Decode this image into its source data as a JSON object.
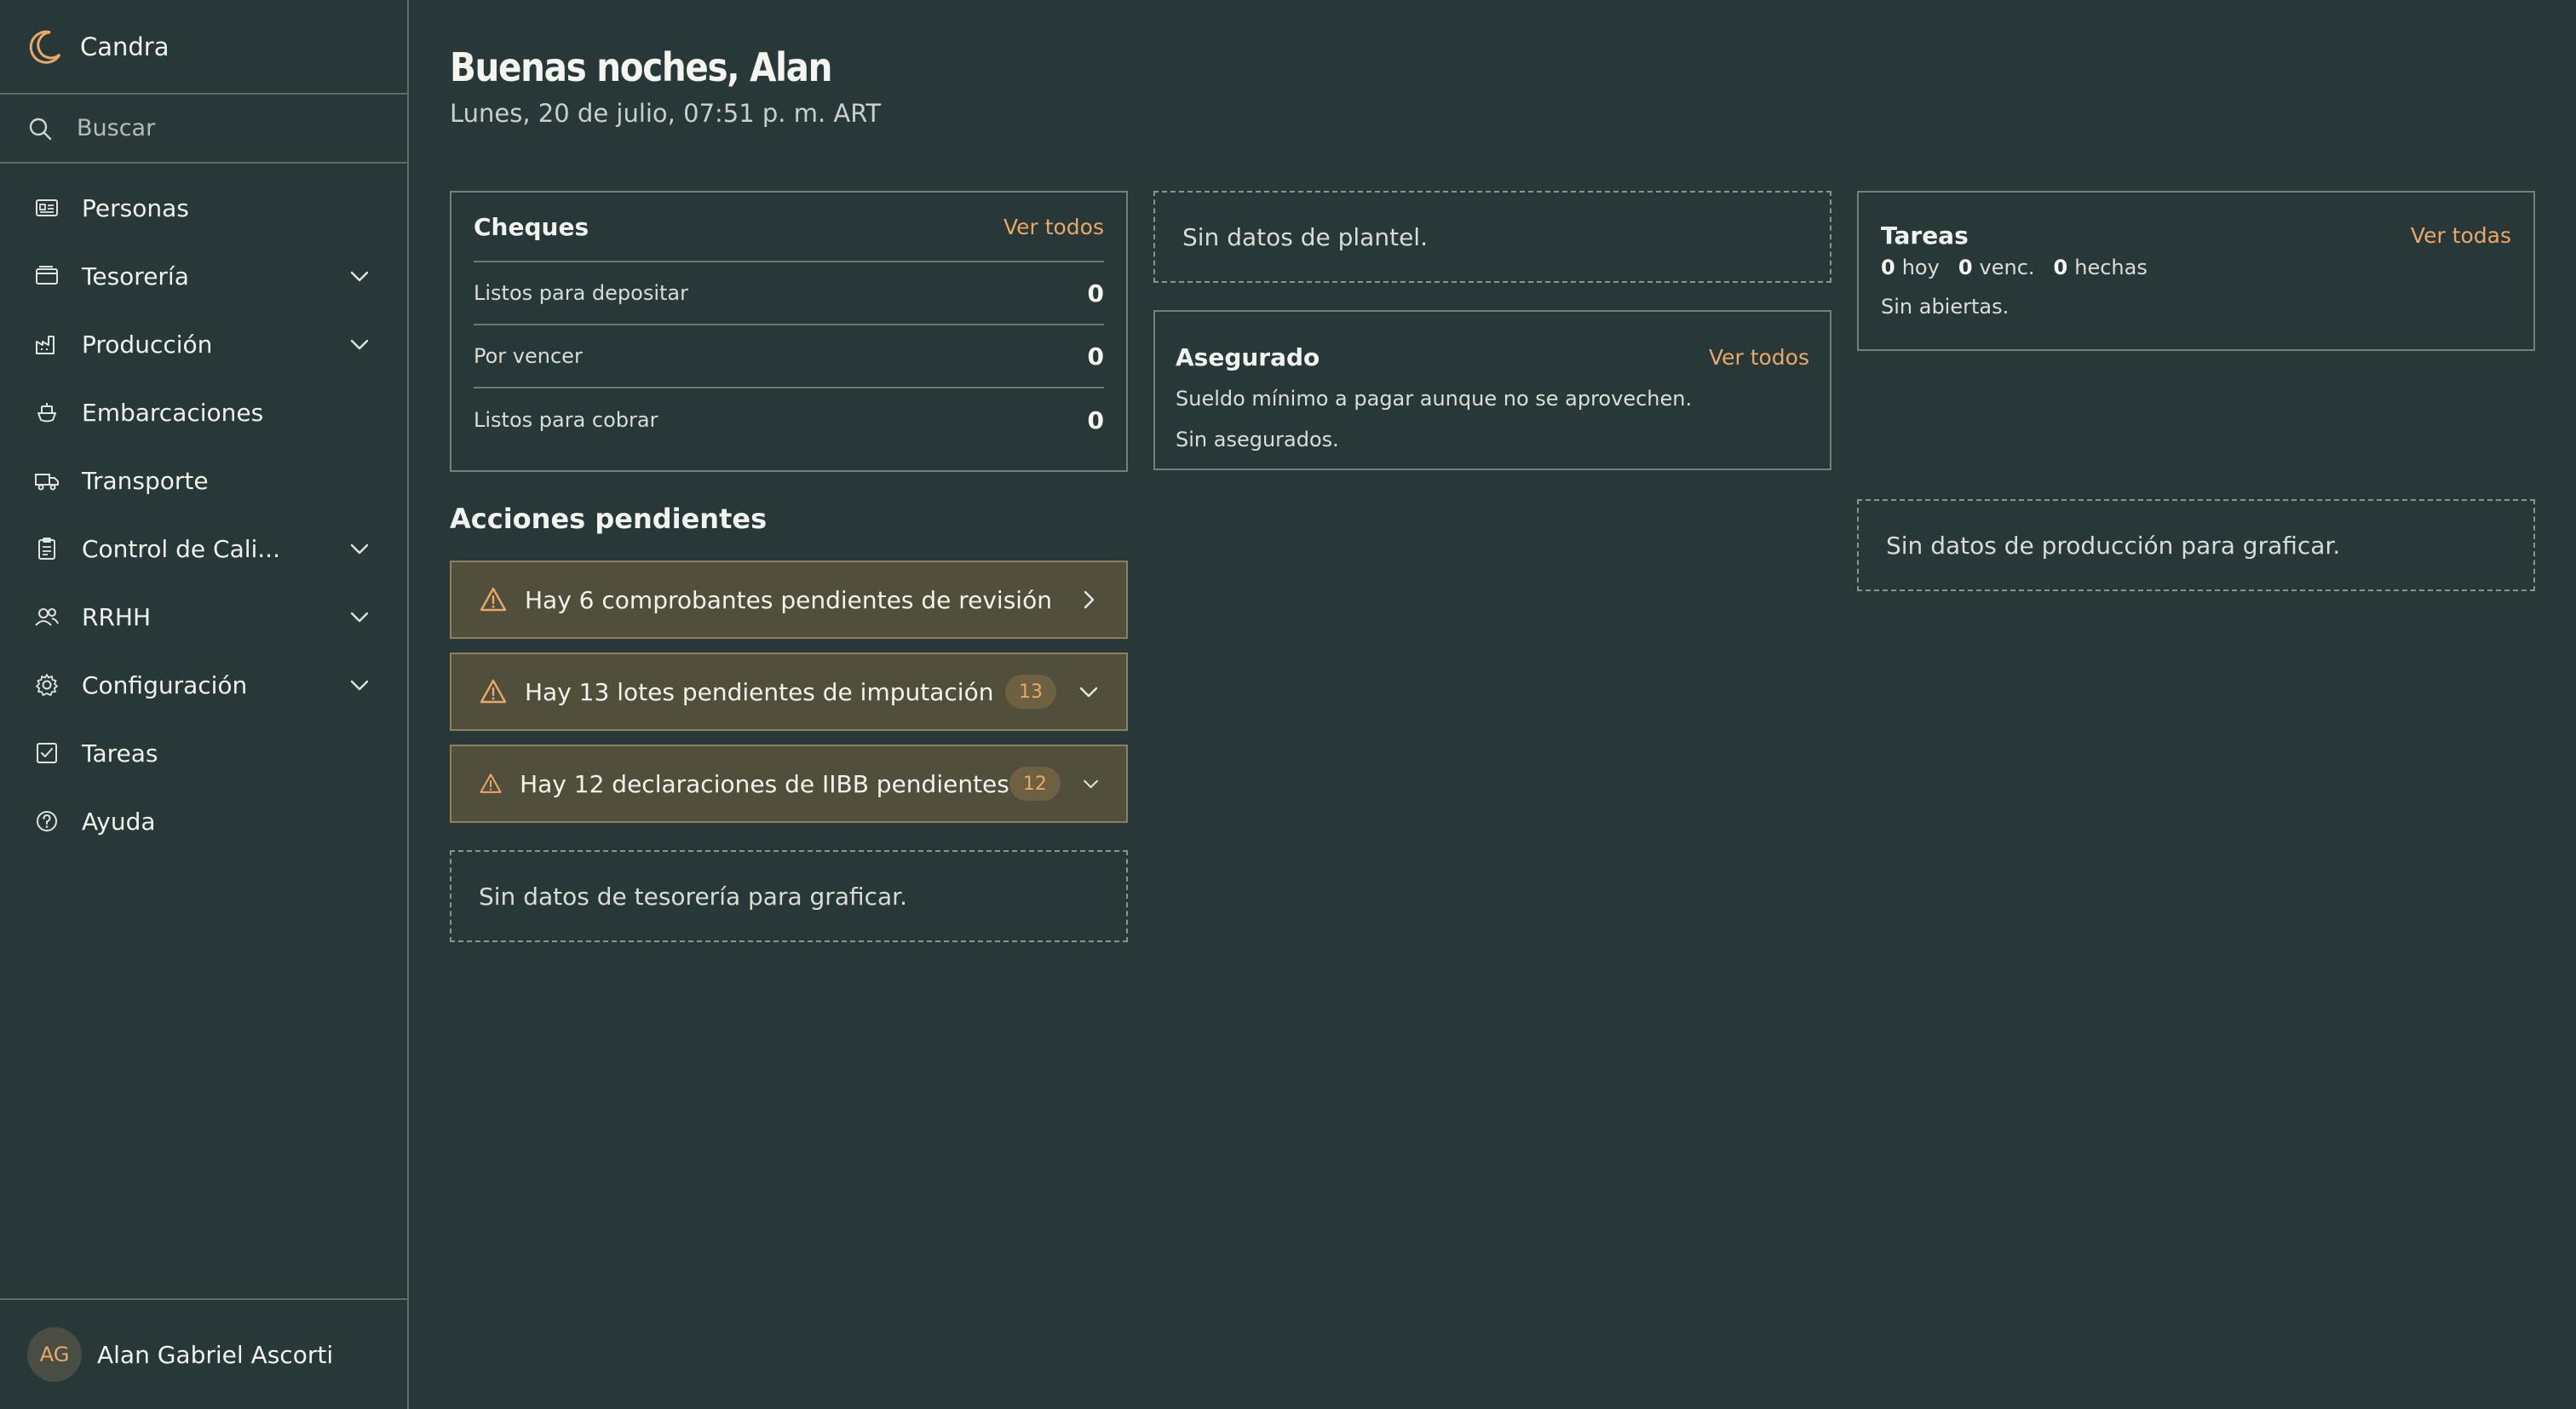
{
  "app": {
    "name": "Candra"
  },
  "sidebar": {
    "search_placeholder": "Buscar",
    "items": [
      {
        "label": "Personas",
        "icon": "id-card-icon",
        "expandable": false
      },
      {
        "label": "Tesorería",
        "icon": "wallet-icon",
        "expandable": true
      },
      {
        "label": "Producción",
        "icon": "factory-icon",
        "expandable": true
      },
      {
        "label": "Embarcaciones",
        "icon": "ship-icon",
        "expandable": false
      },
      {
        "label": "Transporte",
        "icon": "truck-icon",
        "expandable": false
      },
      {
        "label": "Control de Cali...",
        "icon": "clipboard-icon",
        "expandable": true
      },
      {
        "label": "RRHH",
        "icon": "users-icon",
        "expandable": true
      },
      {
        "label": "Configuración",
        "icon": "gear-icon",
        "expandable": true
      },
      {
        "label": "Tareas",
        "icon": "checkbox-icon",
        "expandable": false
      },
      {
        "label": "Ayuda",
        "icon": "help-icon",
        "expandable": false
      }
    ],
    "user": {
      "initials": "AG",
      "name": "Alan Gabriel Ascorti"
    }
  },
  "header": {
    "greeting": "Buenas noches, Alan",
    "date": "Lunes, 20 de julio, 07:51 p. m. ART"
  },
  "cheques": {
    "title": "Cheques",
    "link": "Ver todos",
    "rows": [
      {
        "label": "Listos para depositar",
        "value": "0"
      },
      {
        "label": "Por vencer",
        "value": "0"
      },
      {
        "label": "Listos para cobrar",
        "value": "0"
      }
    ]
  },
  "plantel": {
    "empty": "Sin datos de plantel."
  },
  "asegurado": {
    "title": "Asegurado",
    "link": "Ver todos",
    "description": "Sueldo mínimo a pagar aunque no se aprovechen.",
    "empty": "Sin asegurados."
  },
  "tareas": {
    "title": "Tareas",
    "link": "Ver todas",
    "hoy_value": "0",
    "hoy_label": "hoy",
    "venc_value": "0",
    "venc_label": "venc.",
    "hechas_value": "0",
    "hechas_label": "hechas",
    "empty": "Sin abiertas."
  },
  "acciones": {
    "title": "Acciones pendientes",
    "items": [
      {
        "text": "Hay 6 comprobantes pendientes de revisión",
        "badge": null
      },
      {
        "text": "Hay 13 lotes pendientes de imputación",
        "badge": "13"
      },
      {
        "text": "Hay 12 declaraciones de IIBB pendientes",
        "badge": "12"
      }
    ]
  },
  "tesoreria": {
    "empty": "Sin datos de tesorería para graficar."
  },
  "produccion": {
    "empty": "Sin datos de producción para graficar."
  },
  "colors": {
    "background": "#283737",
    "accent": "#eba767",
    "alert_bg": "#514e3b",
    "border": "#73807d"
  }
}
